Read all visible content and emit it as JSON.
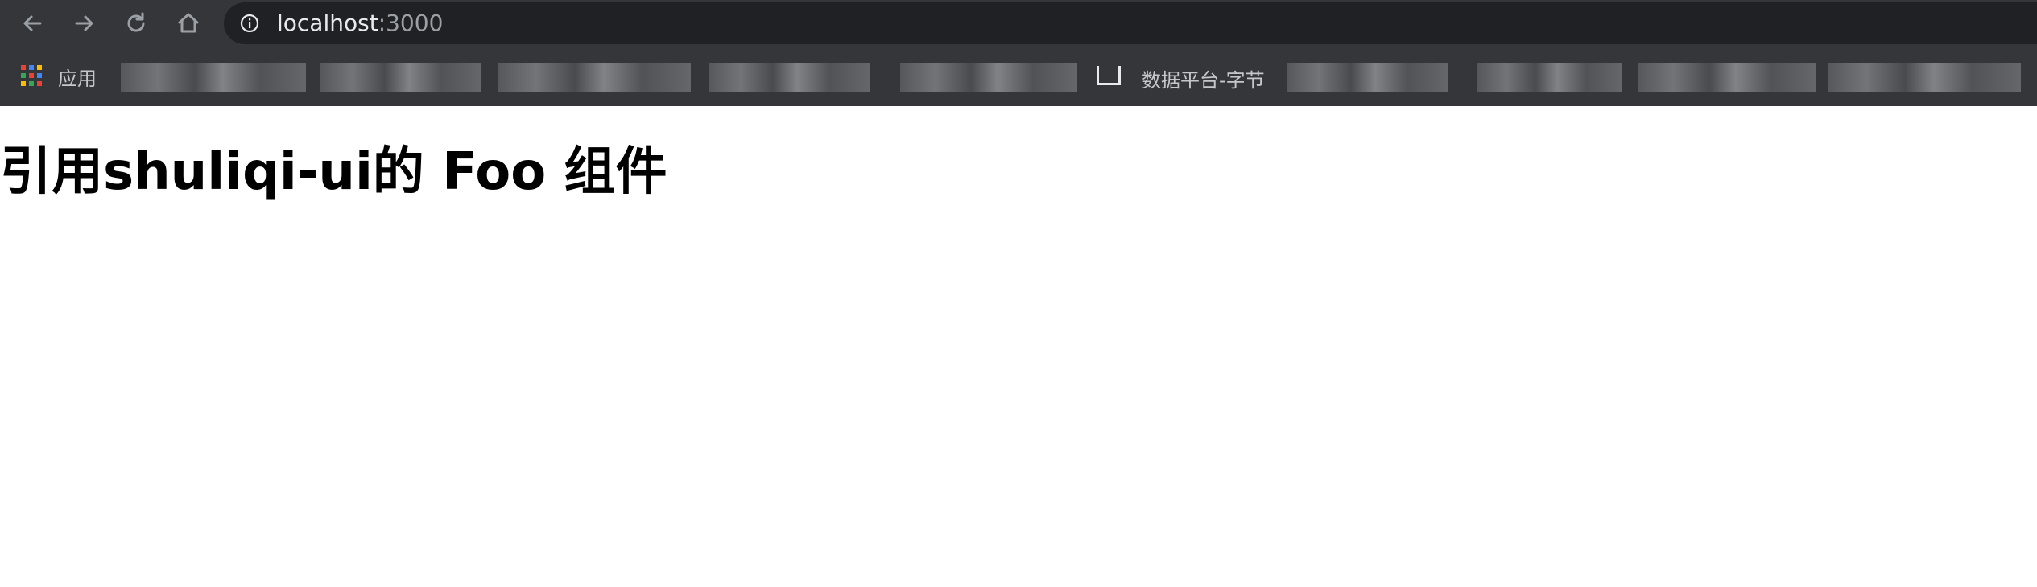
{
  "browser": {
    "url_host": "localhost",
    "url_port": ":3000",
    "icons": {
      "back": "arrow-left-icon",
      "forward": "arrow-right-icon",
      "reload": "reload-icon",
      "home": "home-icon",
      "site_info": "info-icon",
      "apps": "apps-grid-icon"
    }
  },
  "bookmarks": {
    "apps_label": "应用",
    "items": [
      {
        "label": ""
      },
      {
        "label": "数据平台-字节"
      }
    ]
  },
  "page": {
    "heading": "引用shuliqi-ui的 Foo 组件"
  },
  "colors": {
    "chrome_bg": "#35363a",
    "omnibox_bg": "#202124",
    "url_text": "#e8eaed",
    "url_port": "#9aa0a6",
    "page_bg": "#ffffff",
    "heading": "#000000",
    "apps_grid": [
      "#ea4335",
      "#4285f4",
      "#fbbc05",
      "#34a853",
      "#ea4335",
      "#4285f4",
      "#fbbc05",
      "#34a853",
      "#ea4335"
    ]
  }
}
